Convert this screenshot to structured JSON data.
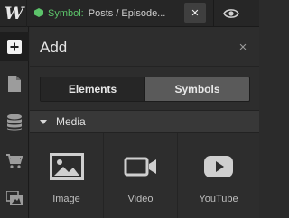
{
  "topbar": {
    "logo": "W",
    "symbol_label": "Symbol:",
    "symbol_path": "Posts / Episode...",
    "close_symbol": "✕"
  },
  "rail": {
    "items": [
      "add",
      "pages",
      "cms",
      "ecommerce",
      "assets"
    ]
  },
  "panel": {
    "title": "Add",
    "close": "×",
    "tabs": {
      "elements": "Elements",
      "symbols": "Symbols"
    },
    "section": "Media",
    "tiles": [
      {
        "label": "Image",
        "icon": "image-icon"
      },
      {
        "label": "Video",
        "icon": "video-icon"
      },
      {
        "label": "YouTube",
        "icon": "youtube-icon"
      }
    ]
  },
  "colors": {
    "accent_green": "#5cc36a",
    "panel_bg": "#2d2d2d",
    "icon_fill": "#cfcfcf"
  }
}
